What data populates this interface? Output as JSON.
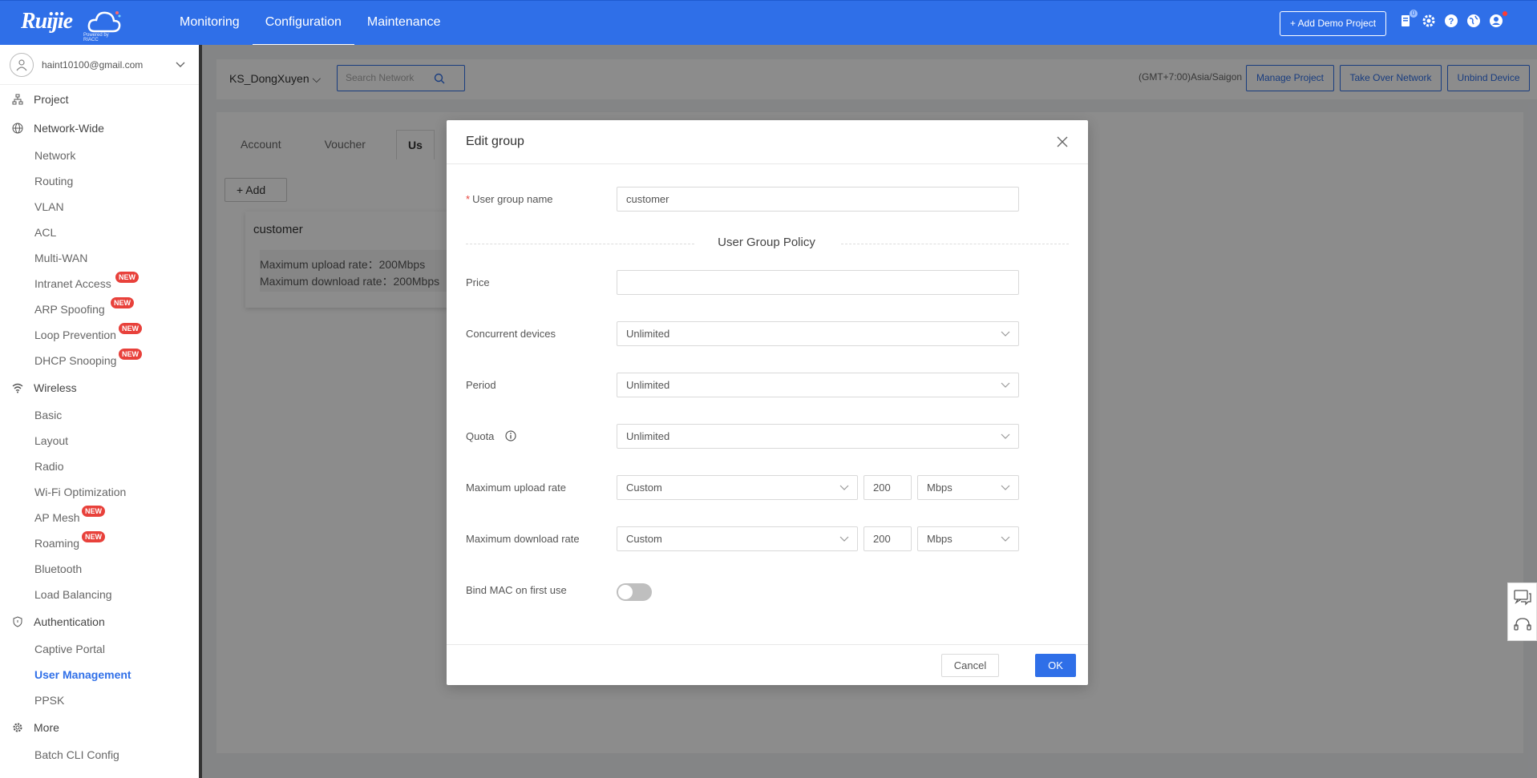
{
  "brand": {
    "logo_text": "Ruijie",
    "logo_sub": "Powered by RIACC"
  },
  "nav": {
    "tabs": [
      {
        "label": "Monitoring"
      },
      {
        "label": "Configuration"
      },
      {
        "label": "Maintenance"
      }
    ],
    "active": "Configuration"
  },
  "header": {
    "add_demo_label": "+ Add Demo Project",
    "notification_count": "0"
  },
  "sidebar": {
    "user_email": "haint10100@gmail.com",
    "groups": [
      {
        "label": "Project",
        "icon": "sitemap-icon",
        "items": []
      },
      {
        "label": "Network-Wide",
        "icon": "globe-icon",
        "items": [
          {
            "label": "Network"
          },
          {
            "label": "Routing"
          },
          {
            "label": "VLAN"
          },
          {
            "label": "ACL"
          },
          {
            "label": "Multi-WAN"
          },
          {
            "label": "Intranet Access",
            "tag": "NEW"
          },
          {
            "label": "ARP Spoofing",
            "tag": "NEW"
          },
          {
            "label": "Loop Prevention",
            "tag": "NEW"
          },
          {
            "label": "DHCP Snooping",
            "tag": "NEW"
          }
        ]
      },
      {
        "label": "Wireless",
        "icon": "wifi-icon",
        "items": [
          {
            "label": "Basic"
          },
          {
            "label": "Layout"
          },
          {
            "label": "Radio"
          },
          {
            "label": "Wi-Fi Optimization"
          },
          {
            "label": "AP Mesh",
            "tag": "NEW"
          },
          {
            "label": "Roaming",
            "tag": "NEW"
          },
          {
            "label": "Bluetooth"
          },
          {
            "label": "Load Balancing"
          }
        ]
      },
      {
        "label": "Authentication",
        "icon": "shield-icon",
        "items": [
          {
            "label": "Captive Portal"
          },
          {
            "label": "User Management"
          },
          {
            "label": "PPSK"
          }
        ]
      },
      {
        "label": "More",
        "icon": "gear-icon",
        "items": [
          {
            "label": "Batch CLI Config"
          }
        ]
      }
    ],
    "active_item": "User Management"
  },
  "subheader": {
    "project_name": "KS_DongXuyen",
    "search_placeholder": "Search Network",
    "timezone": "(GMT+7:00)Asia/Saigon",
    "buttons": [
      {
        "label": "Manage Project"
      },
      {
        "label": "Take Over Network"
      },
      {
        "label": "Unbind Device"
      }
    ]
  },
  "content": {
    "tabs": [
      {
        "label": "Account"
      },
      {
        "label": "Voucher"
      },
      {
        "label": "Us"
      }
    ],
    "add_label": "Add",
    "group_card": {
      "title": "customer",
      "upload_line": "Maximum upload rate：200Mbps",
      "download_line": "Maximum download rate：200Mbps"
    }
  },
  "modal": {
    "title": "Edit group",
    "group_name_label": "User group name",
    "group_name_value": "customer",
    "section_title": "User Group Policy",
    "price_label": "Price",
    "price_value": "",
    "concurrent_label": "Concurrent devices",
    "concurrent_value": "Unlimited",
    "period_label": "Period",
    "period_value": "Unlimited",
    "quota_label": "Quota",
    "quota_value": "Unlimited",
    "upload_label": "Maximum upload rate",
    "upload_mode": "Custom",
    "upload_value": "200",
    "upload_unit": "Mbps",
    "download_label": "Maximum download rate",
    "download_mode": "Custom",
    "download_value": "200",
    "download_unit": "Mbps",
    "bind_mac_label": "Bind MAC on first use",
    "bind_mac_on": false,
    "cancel_label": "Cancel",
    "ok_label": "OK"
  },
  "colors": {
    "primary": "#2f6fe8",
    "new_tag": "#e8413b"
  }
}
